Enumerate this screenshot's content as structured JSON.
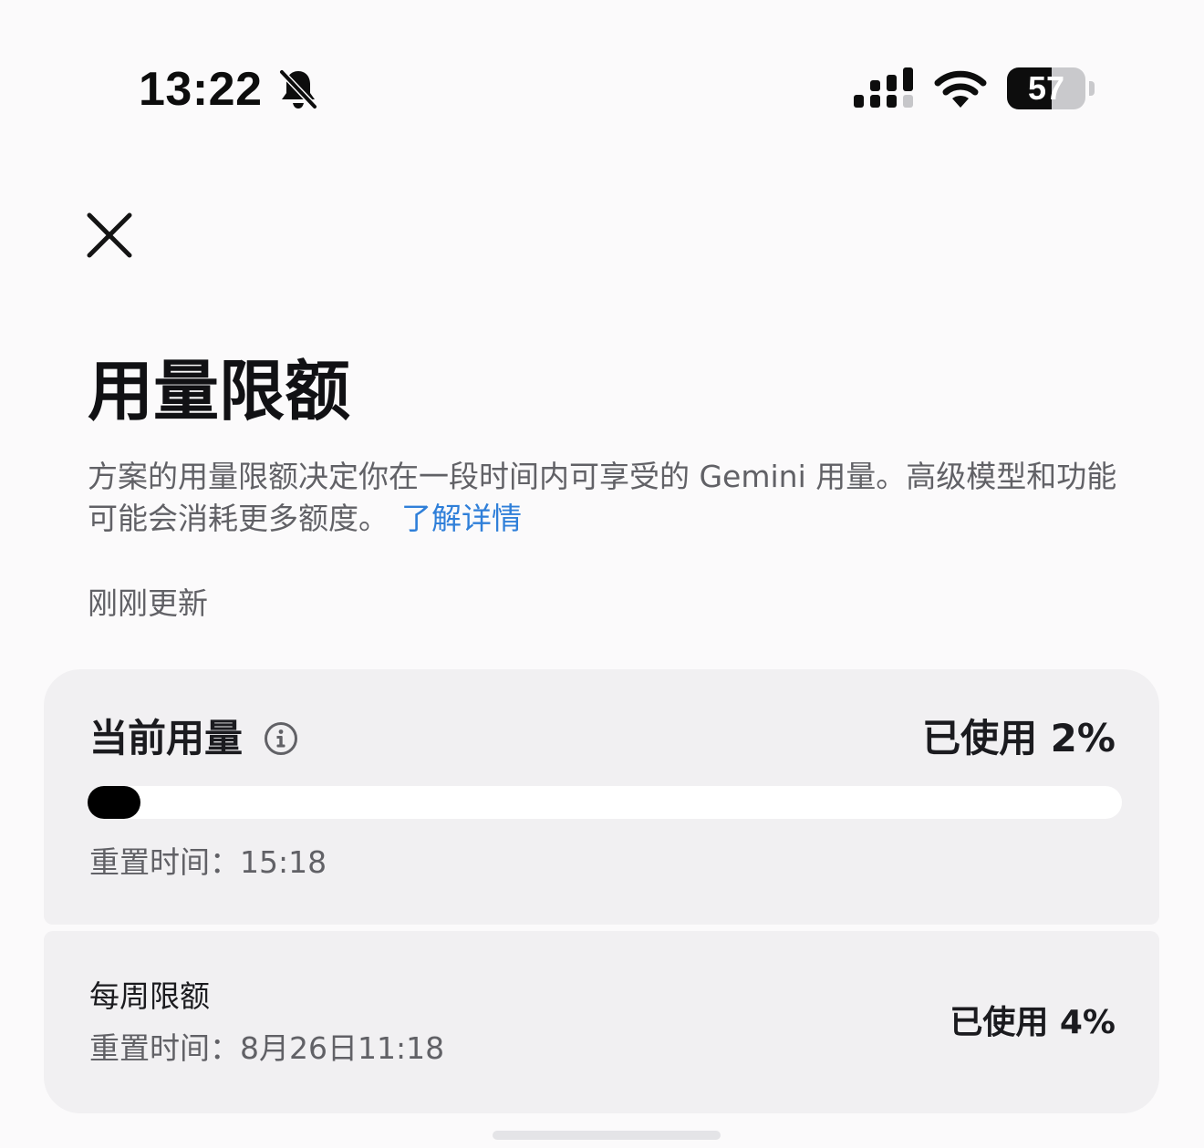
{
  "status_bar": {
    "time": "13:22",
    "battery_level": "57",
    "battery_fraction": 0.57,
    "icons": [
      "bell-off-icon",
      "signal-icon",
      "wifi-icon",
      "battery-icon"
    ]
  },
  "header": {
    "close_icon": "close-icon",
    "title": "用量限额",
    "description": "方案的用量限额决定你在一段时间内可享受的 Gemini 用量。高级模型和功能可能会消耗更多额度。",
    "learn_more": "了解详情",
    "updated": "刚刚更新"
  },
  "current_usage": {
    "title": "当前用量",
    "info_icon": "info-icon",
    "used_label": "已使用 2%",
    "used_percent": 2,
    "reset_label": "重置时间：15:18"
  },
  "weekly_limit": {
    "title": "每周限额",
    "reset_label": "重置时间：8月26日11:18",
    "used_label": "已使用 4%",
    "used_percent": 4
  },
  "colors": {
    "background": "#fbfafb",
    "card": "#f1f0f2",
    "link": "#2f7fd9",
    "progress_fill": "#000000",
    "progress_track": "#ffffff",
    "secondary_text": "#616166"
  }
}
